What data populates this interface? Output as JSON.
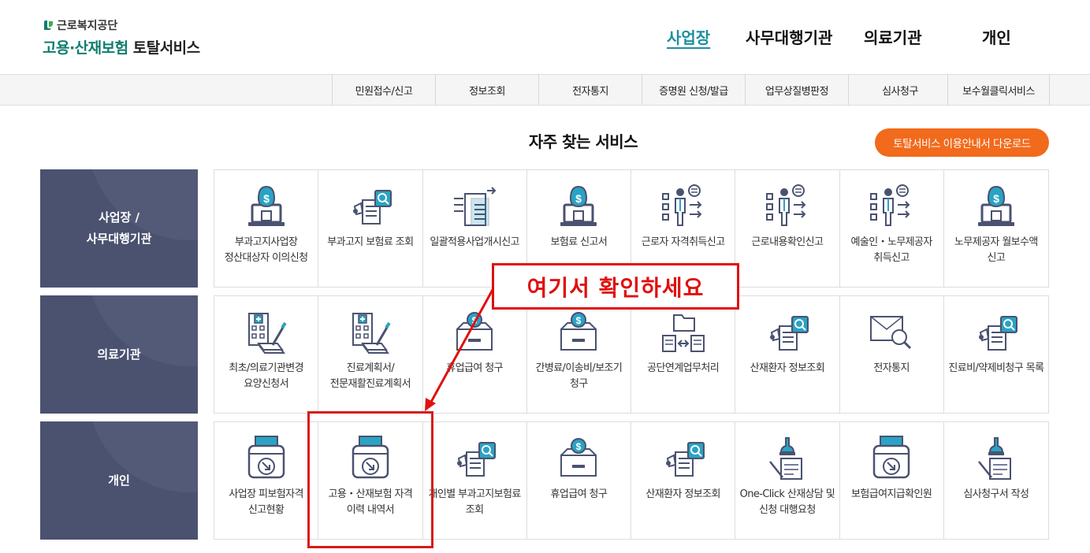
{
  "logo": {
    "org": "근로복지공단",
    "title_green": "고용·산재보험",
    "title_dark": "토탈서비스"
  },
  "topnav": [
    "사업장",
    "사무대행기관",
    "의료기관",
    "개인"
  ],
  "submenu": [
    "민원접수/신고",
    "정보조회",
    "전자통지",
    "증명원 신청/발급",
    "업무상질병판정",
    "심사청구",
    "보수월클릭서비스"
  ],
  "section_title": "자주 찾는 서비스",
  "download_button": "토탈서비스 이용안내서 다운로드",
  "categories": [
    {
      "name_line1": "사업장 /",
      "name_line2": "사무대행기관",
      "services": [
        {
          "label": "부과고지사업장 정산대상자 이의신청",
          "icon": "money-laptop-icon"
        },
        {
          "label": "부과고지 보험료 조회",
          "icon": "document-search-icon"
        },
        {
          "label": "일괄적용사업개시신고",
          "icon": "document-transfer-icon"
        },
        {
          "label": "보험료 신고서",
          "icon": "money-laptop-icon"
        },
        {
          "label": "근로자 자격취득신고",
          "icon": "person-checklist-icon"
        },
        {
          "label": "근로내용확인신고",
          "icon": "person-checklist-icon"
        },
        {
          "label": "예술인・노무제공자 취득신고",
          "icon": "person-checklist-icon"
        },
        {
          "label": "노무제공자 월보수액 신고",
          "icon": "money-laptop-icon"
        }
      ]
    },
    {
      "name_line1": "의료기관",
      "name_line2": "",
      "services": [
        {
          "label": "최초/의료기관변경 요양신청서",
          "icon": "hospital-document-icon"
        },
        {
          "label": "진료계획서/전문재활진료계획서",
          "icon": "hospital-document-icon"
        },
        {
          "label": "휴업급여 청구",
          "icon": "money-box-icon"
        },
        {
          "label": "간병료/이송비/보조기 청구",
          "icon": "money-box-icon"
        },
        {
          "label": "공단연계업무처리",
          "icon": "folder-exchange-icon"
        },
        {
          "label": "산재환자 정보조회",
          "icon": "document-search-icon"
        },
        {
          "label": "전자통지",
          "icon": "mail-search-icon"
        },
        {
          "label": "진료비/약제비청구 목록",
          "icon": "document-search-icon"
        }
      ]
    },
    {
      "name_line1": "개인",
      "name_line2": "",
      "services": [
        {
          "label": "사업장 피보험자격 신고현황",
          "icon": "printer-download-icon"
        },
        {
          "label": "고용・산재보험 자격 이력 내역서",
          "icon": "printer-download-icon"
        },
        {
          "label": "개인별 부과고지보험료 조회",
          "icon": "document-search-icon"
        },
        {
          "label": "휴업급여 청구",
          "icon": "money-box-icon"
        },
        {
          "label": "산재환자 정보조회",
          "icon": "document-search-icon"
        },
        {
          "label": "One-Click 산재상담 및 신청 대행요청",
          "icon": "stamp-document-icon"
        },
        {
          "label": "보험급여지급확인원",
          "icon": "printer-download-icon"
        },
        {
          "label": "심사청구서 작성",
          "icon": "stamp-document-icon"
        }
      ]
    }
  ],
  "annotation": {
    "callout": "여기서 확인하세요"
  },
  "colors": {
    "brand_green": "#0f7d6e",
    "active_nav": "#1c8fa0",
    "category_bg": "#4a5270",
    "download_btn": "#f26a1b",
    "annotation_red": "#e01010",
    "icon_navy": "#4a5270",
    "icon_blue": "#2aa3c4"
  }
}
